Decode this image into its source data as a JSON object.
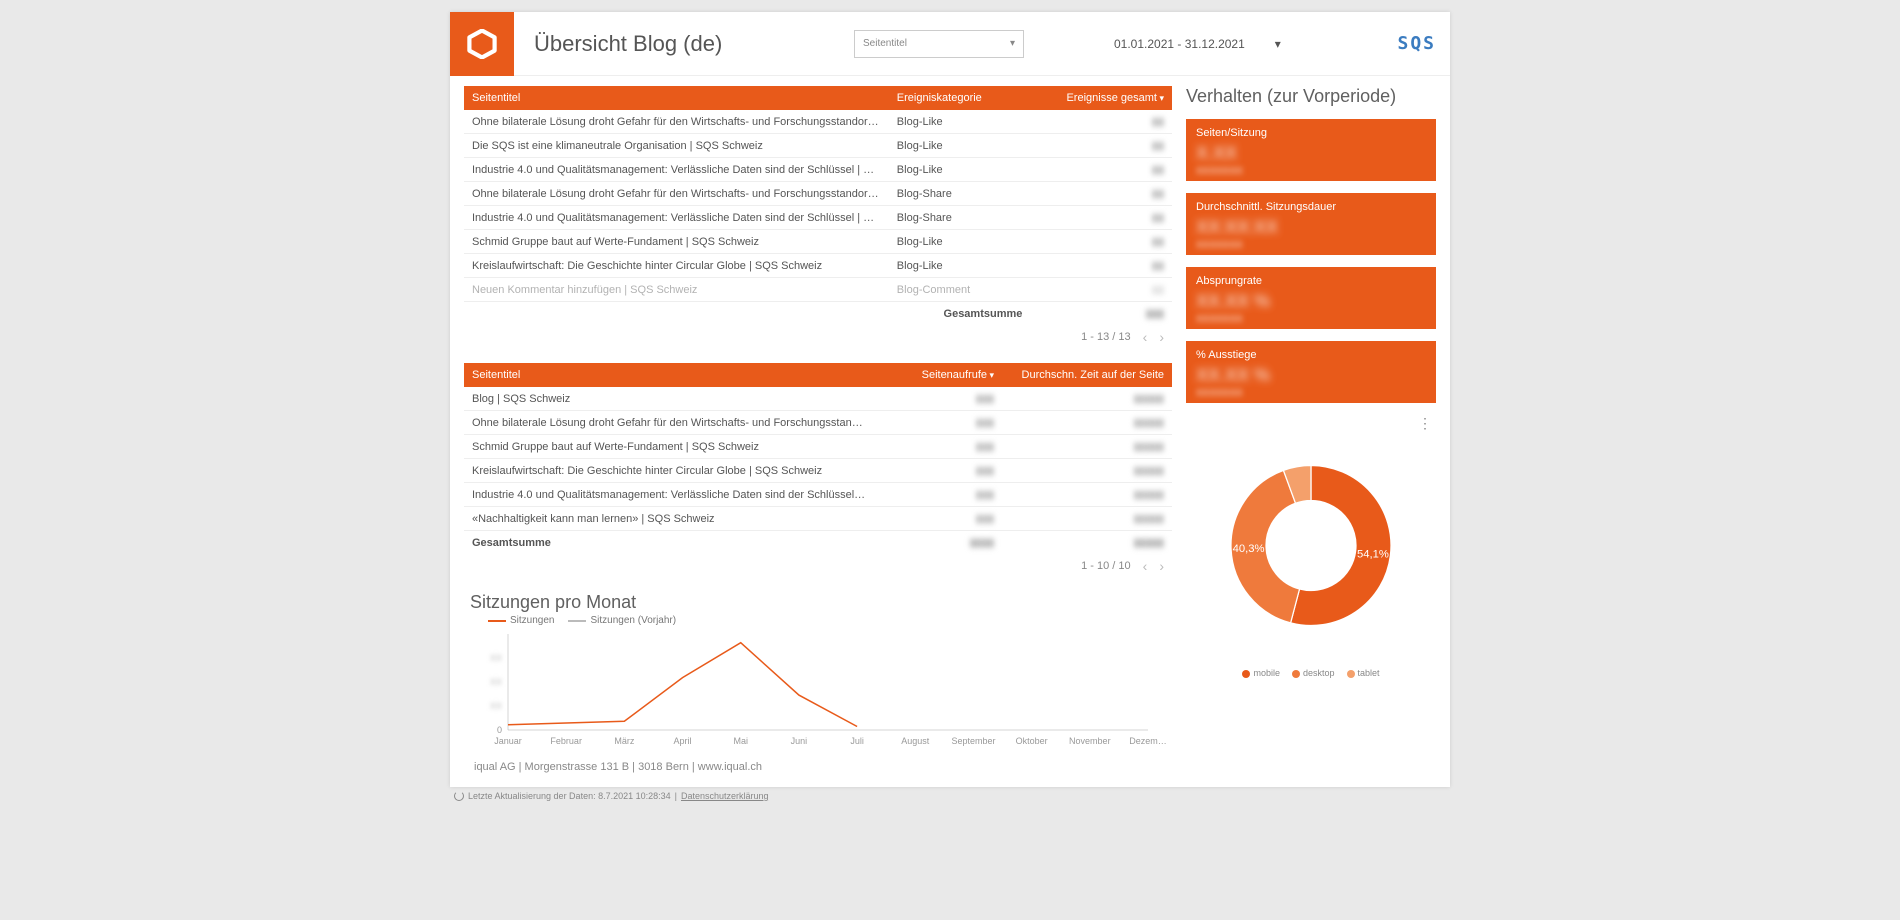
{
  "header": {
    "title": "Übersicht Blog (de)",
    "filter_label": "Seitentitel",
    "filter_caret": "▾",
    "date_range": "01.01.2021 - 31.12.2021",
    "date_caret": "▾",
    "brand": "SQS"
  },
  "table1": {
    "cols": {
      "c1": "Seitentitel",
      "c2": "Ereigniskategorie",
      "c3": "Ereignisse gesamt"
    },
    "rows": [
      {
        "title": "Ohne bilaterale Lösung droht Gefahr für den Wirtschafts- und Forschungsstandort Schweiz | SQ…",
        "cat": "Blog-Like",
        "val": "▮▮"
      },
      {
        "title": "Die SQS ist eine klimaneutrale Organisation | SQS Schweiz",
        "cat": "Blog-Like",
        "val": "▮▮"
      },
      {
        "title": "Industrie 4.0 und Qualitätsmanagement: Verlässliche Daten sind der Schlüssel | SQS Schweiz",
        "cat": "Blog-Like",
        "val": "▮▮"
      },
      {
        "title": "Ohne bilaterale Lösung droht Gefahr für den Wirtschafts- und Forschungsstandort Schweiz | SQ…",
        "cat": "Blog-Share",
        "val": "▮▮"
      },
      {
        "title": "Industrie 4.0 und Qualitätsmanagement: Verlässliche Daten sind der Schlüssel | SQS Schweiz",
        "cat": "Blog-Share",
        "val": "▮▮"
      },
      {
        "title": "Schmid Gruppe baut auf Werte-Fundament | SQS Schweiz",
        "cat": "Blog-Like",
        "val": "▮▮"
      },
      {
        "title": "Kreislaufwirtschaft: Die Geschichte hinter Circular Globe | SQS Schweiz",
        "cat": "Blog-Like",
        "val": "▮▮"
      },
      {
        "title": "Neuen Kommentar hinzufügen | SQS Schweiz",
        "cat": "Blog-Comment",
        "val": "▮▮"
      }
    ],
    "sum_label": "Gesamtsumme",
    "sum_val": "▮▮▮",
    "pager": "1 - 13 / 13"
  },
  "table2": {
    "cols": {
      "c1": "Seitentitel",
      "c2": "Seitenaufrufe",
      "c3": "Durchschn. Zeit auf der Seite"
    },
    "rows": [
      {
        "title": "Blog | SQS Schweiz",
        "v1": "▮▮▮",
        "v2": "▮▮▮▮▮"
      },
      {
        "title": "Ohne bilaterale Lösung droht Gefahr für den Wirtschafts- und Forschungsstand…",
        "v1": "▮▮▮",
        "v2": "▮▮▮▮▮"
      },
      {
        "title": "Schmid Gruppe baut auf Werte-Fundament | SQS Schweiz",
        "v1": "▮▮▮",
        "v2": "▮▮▮▮▮"
      },
      {
        "title": "Kreislaufwirtschaft: Die Geschichte hinter Circular Globe | SQS Schweiz",
        "v1": "▮▮▮",
        "v2": "▮▮▮▮▮"
      },
      {
        "title": "Industrie 4.0 und Qualitätsmanagement: Verlässliche Daten sind der Schlüssel | …",
        "v1": "▮▮▮",
        "v2": "▮▮▮▮▮"
      },
      {
        "title": "«Nachhaltigkeit kann man lernen» | SQS Schweiz",
        "v1": "▮▮▮",
        "v2": "▮▮▮▮▮"
      }
    ],
    "sum_label": "Gesamtsumme",
    "sum_v1": "▮▮▮▮",
    "sum_v2": "▮▮▮▮▮",
    "pager": "1 - 10 / 10"
  },
  "right": {
    "title": "Verhalten (zur Vorperiode)",
    "cards": [
      {
        "label": "Seiten/Sitzung",
        "big": "X.XX",
        "sub": "XXXXXXX"
      },
      {
        "label": "Durchschnittl. Sitzungsdauer",
        "big": "XX:XX:XX",
        "sub": "XXXXXXX"
      },
      {
        "label": "Absprungrate",
        "big": "XX.XX %",
        "sub": "XXXXXXX"
      },
      {
        "label": "% Ausstiege",
        "big": "XX.XX %",
        "sub": "XXXXXXX"
      }
    ]
  },
  "chart_data": {
    "type": "line",
    "title": "Sitzungen pro Monat",
    "legend": [
      "Sitzungen",
      "Sitzungen (Vorjahr)"
    ],
    "x": [
      "Januar",
      "Februar",
      "März",
      "April",
      "Mai",
      "Juni",
      "Juli",
      "August",
      "September",
      "Oktober",
      "November",
      "Dezem…"
    ],
    "series": [
      {
        "name": "Sitzungen",
        "values": [
          3,
          4,
          5,
          30,
          50,
          20,
          2,
          null,
          null,
          null,
          null,
          null
        ]
      },
      {
        "name": "Sitzungen (Vorjahr)",
        "values": [
          null,
          null,
          null,
          null,
          null,
          null,
          null,
          null,
          null,
          null,
          null,
          null
        ]
      }
    ],
    "ylim": [
      0,
      55
    ],
    "ylabel": "",
    "xlabel": ""
  },
  "donut_data": {
    "type": "pie",
    "series": [
      {
        "name": "mobile",
        "value": 54.1,
        "label": "54,1%"
      },
      {
        "name": "desktop",
        "value": 40.3,
        "label": "40,3%"
      },
      {
        "name": "tablet",
        "value": 5.6,
        "label": ""
      }
    ]
  },
  "footer": "iqual AG  |  Morgenstrasse 131 B  |  3018 Bern  |  www.iqual.ch",
  "post_footer": {
    "text": "Letzte Aktualisierung der Daten: 8.7.2021 10:28:34",
    "link": "Datenschutzerklärung"
  },
  "colors": {
    "accent": "#e85a1a"
  }
}
